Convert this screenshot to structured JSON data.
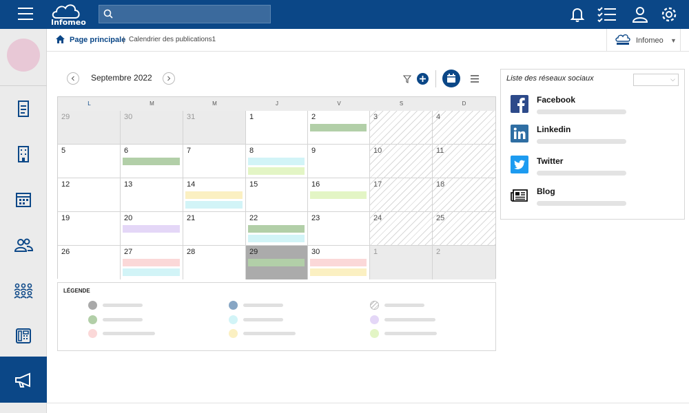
{
  "app": {
    "logo_text": "Infomeo"
  },
  "search": {
    "value": "",
    "placeholder": ""
  },
  "breadcrumb": {
    "home": "Page principale",
    "separator": "|",
    "current": "Calendrier des publications1"
  },
  "org_selector": {
    "name": "Infomeo",
    "caret": "▼"
  },
  "calendar": {
    "month_label": "Septembre 2022",
    "weekdays": [
      "L",
      "M",
      "M",
      "J",
      "V",
      "S",
      "D"
    ],
    "weeks": [
      [
        {
          "d": "29",
          "t": "other"
        },
        {
          "d": "30",
          "t": "other"
        },
        {
          "d": "31",
          "t": "other"
        },
        {
          "d": "1",
          "t": "n"
        },
        {
          "d": "2",
          "t": "n",
          "ev": [
            "#b2cfa8"
          ]
        },
        {
          "d": "3",
          "t": "we"
        },
        {
          "d": "4",
          "t": "we"
        }
      ],
      [
        {
          "d": "5",
          "t": "n"
        },
        {
          "d": "6",
          "t": "n",
          "ev": [
            "#b2cfa8"
          ]
        },
        {
          "d": "7",
          "t": "n"
        },
        {
          "d": "8",
          "t": "n",
          "ev": [
            "#d2f4f7",
            "#e3f5c5"
          ]
        },
        {
          "d": "9",
          "t": "n"
        },
        {
          "d": "10",
          "t": "we"
        },
        {
          "d": "11",
          "t": "we"
        }
      ],
      [
        {
          "d": "12",
          "t": "n"
        },
        {
          "d": "13",
          "t": "n"
        },
        {
          "d": "14",
          "t": "n",
          "ev": [
            "#fbf0c2",
            "#d2f4f7"
          ]
        },
        {
          "d": "15",
          "t": "n"
        },
        {
          "d": "16",
          "t": "n",
          "ev": [
            "#e3f5c5"
          ]
        },
        {
          "d": "17",
          "t": "we"
        },
        {
          "d": "18",
          "t": "we"
        }
      ],
      [
        {
          "d": "19",
          "t": "n"
        },
        {
          "d": "20",
          "t": "n",
          "ev": [
            "#e4d7f7"
          ]
        },
        {
          "d": "21",
          "t": "n"
        },
        {
          "d": "22",
          "t": "n",
          "ev": [
            "#b2cfa8",
            "#d2f4f7"
          ]
        },
        {
          "d": "23",
          "t": "n"
        },
        {
          "d": "24",
          "t": "we"
        },
        {
          "d": "25",
          "t": "we"
        }
      ],
      [
        {
          "d": "26",
          "t": "n"
        },
        {
          "d": "27",
          "t": "n",
          "ev": [
            "#fbd8d8",
            "#d2f4f7"
          ]
        },
        {
          "d": "28",
          "t": "n"
        },
        {
          "d": "29",
          "t": "today",
          "ev": [
            "#b2cfa8"
          ]
        },
        {
          "d": "30",
          "t": "n",
          "ev": [
            "#fbd8d8",
            "#fbf0c2"
          ]
        },
        {
          "d": "1",
          "t": "other"
        },
        {
          "d": "2",
          "t": "other"
        }
      ]
    ]
  },
  "legend": {
    "title": "LÉGENDE",
    "items": [
      {
        "color": "#a9a9a9"
      },
      {
        "color": "#87a6c4"
      },
      {
        "color": "striped"
      },
      {
        "color": "#b2cfa8"
      },
      {
        "color": "#d2f4f7"
      },
      {
        "color": "#e4d7f7"
      },
      {
        "color": "#fbd8d8"
      },
      {
        "color": "#fbf0c2"
      },
      {
        "color": "#e3f5c5"
      }
    ]
  },
  "social_panel": {
    "title": "Liste des réseaux sociaux",
    "select_value": "",
    "networks": [
      {
        "name": "Facebook",
        "icon": "facebook-icon"
      },
      {
        "name": "Linkedin",
        "icon": "linkedin-icon"
      },
      {
        "name": "Twitter",
        "icon": "twitter-icon"
      },
      {
        "name": "Blog",
        "icon": "newspaper-icon"
      }
    ]
  },
  "colors": {
    "brand": "#0b4787",
    "accent": "#0b4787"
  }
}
